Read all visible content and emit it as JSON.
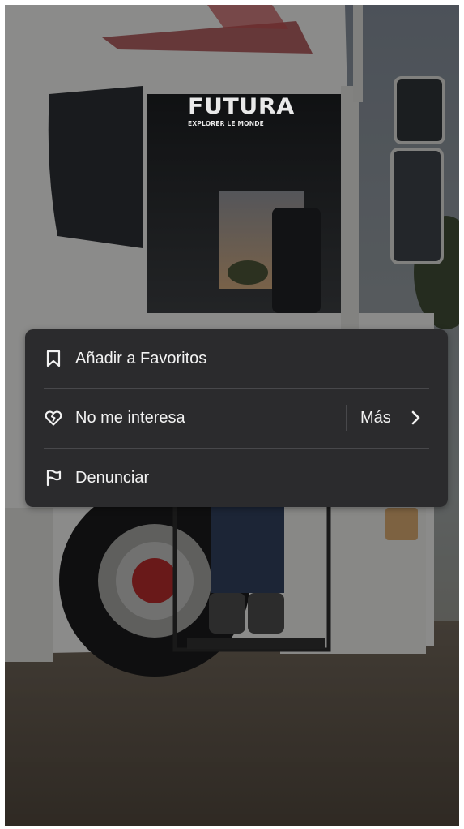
{
  "background": {
    "description_icon": "truck-video-frame",
    "watermark": {
      "name": "FUTURA",
      "tagline": "EXPLORER LE MONDE"
    }
  },
  "menu": {
    "items": [
      {
        "label": "Añadir a Favoritos",
        "icon": "bookmark-icon"
      },
      {
        "label": "No me interesa",
        "icon": "broken-heart-icon",
        "more_label": "Más",
        "more_icon": "chevron-right-icon"
      },
      {
        "label": "Denunciar",
        "icon": "flag-icon"
      }
    ]
  },
  "colors": {
    "menu_bg": "#2b2b2d",
    "text": "#f2f2f2",
    "divider": "#48484b"
  }
}
